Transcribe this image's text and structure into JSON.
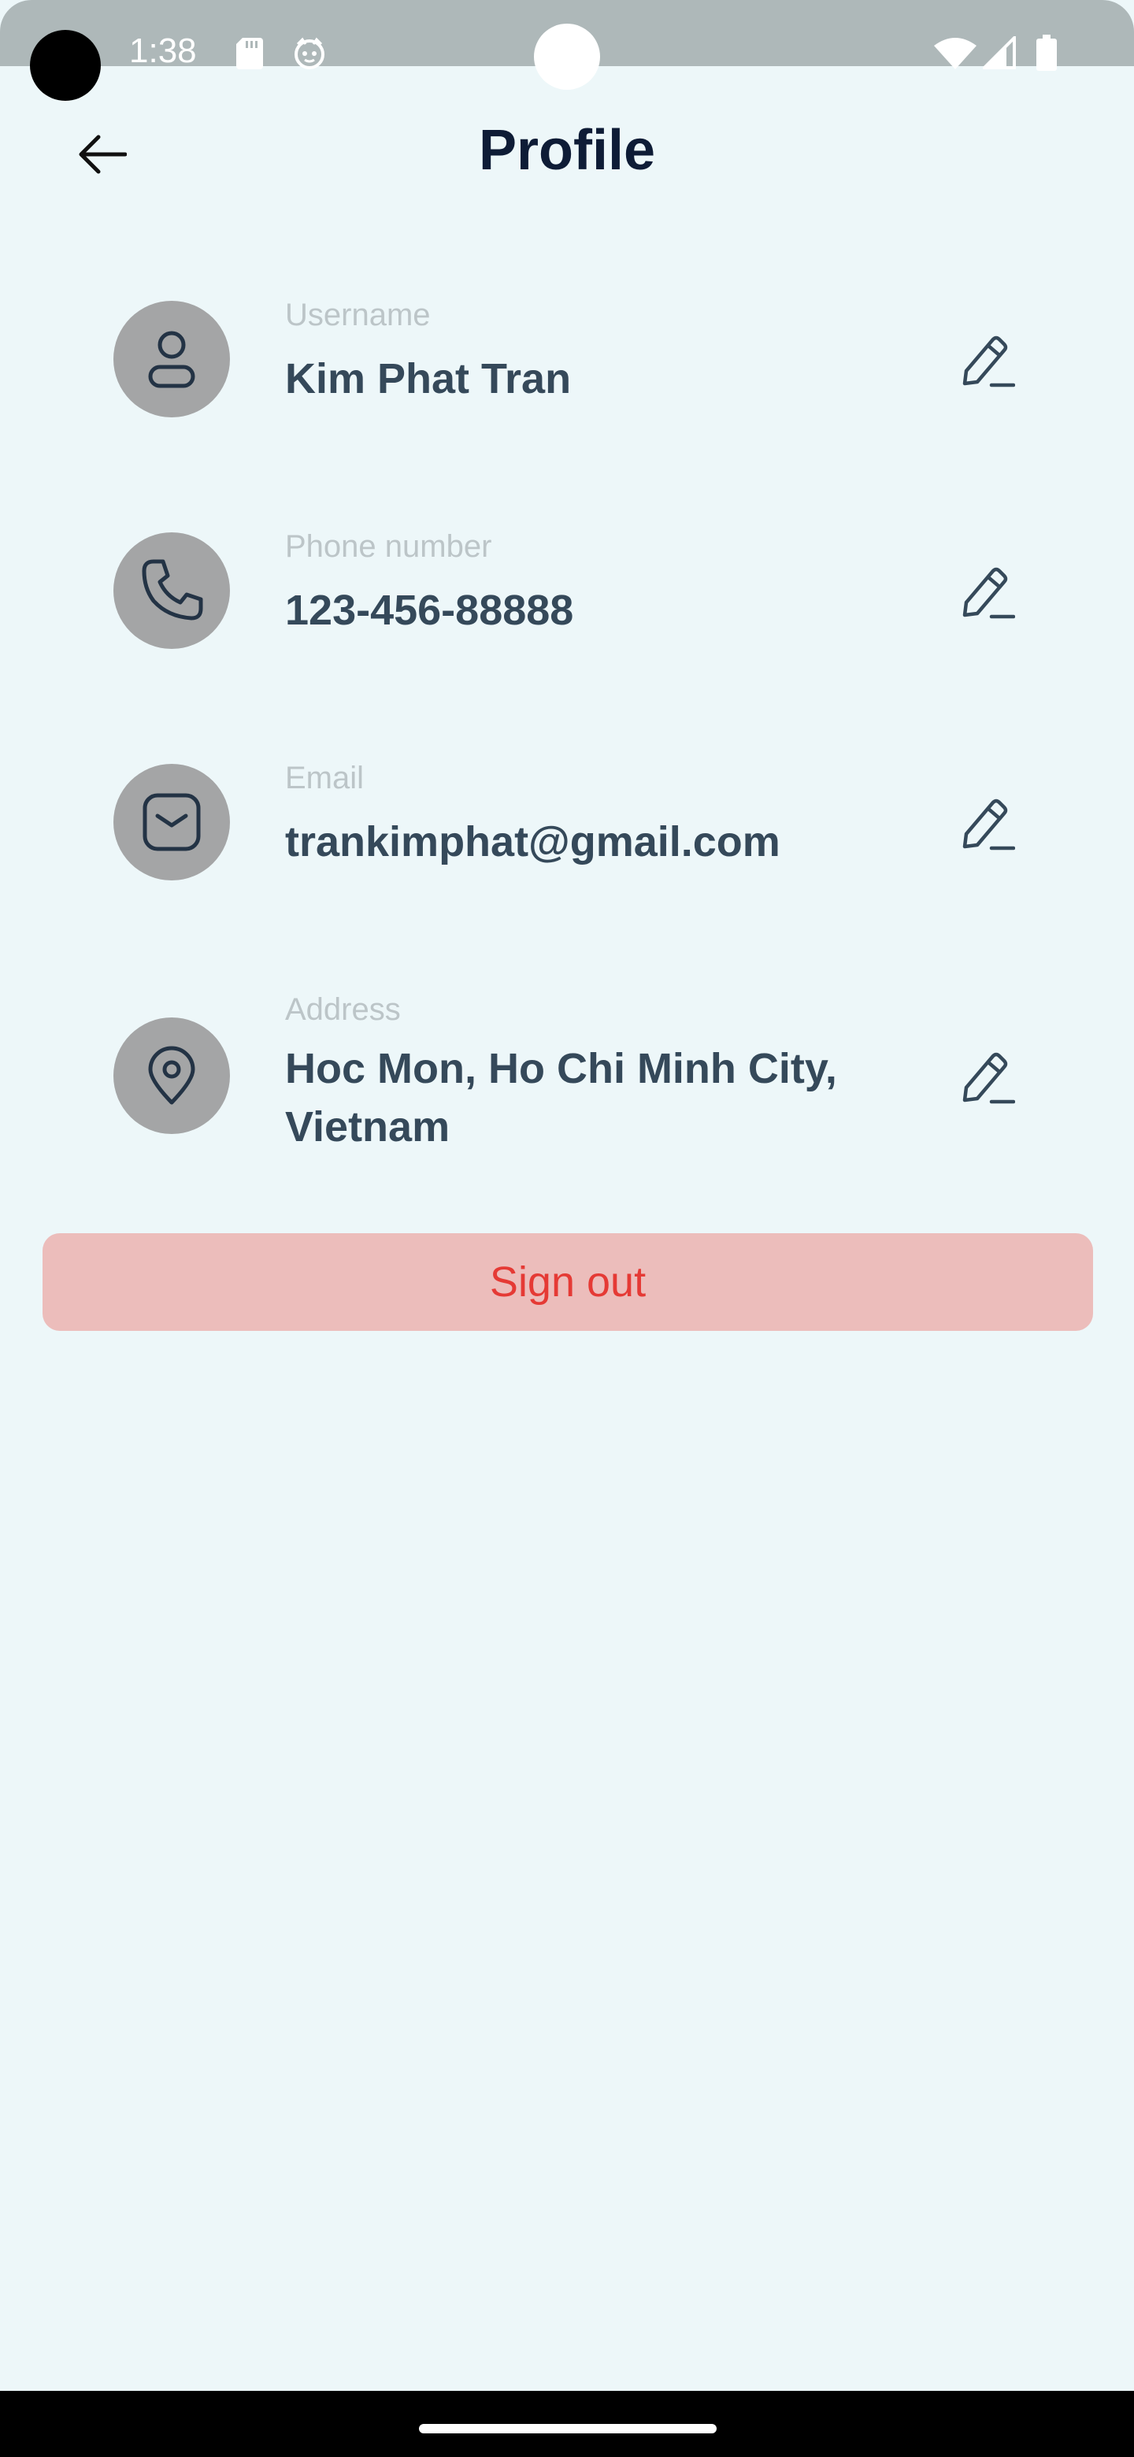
{
  "status_bar": {
    "time": "1:38",
    "icons": [
      "sd-card-icon",
      "cat-icon",
      "wifi-icon",
      "signal-icon",
      "battery-icon"
    ]
  },
  "header": {
    "title": "Profile",
    "back_icon": "arrow-left-icon"
  },
  "fields": [
    {
      "label": "Username",
      "value": "Kim Phat Tran",
      "icon": "user-icon"
    },
    {
      "label": "Phone number",
      "value": "123-456-88888",
      "icon": "phone-icon"
    },
    {
      "label": "Email",
      "value": "trankimphat@gmail.com",
      "icon": "mail-icon"
    },
    {
      "label": "Address",
      "value": "Hoc Mon, Ho Chi Minh City, Vietnam",
      "icon": "location-pin-icon"
    }
  ],
  "actions": {
    "sign_out_label": "Sign out",
    "edit_icon": "pencil-icon"
  },
  "colors": {
    "background": "#edf7f9",
    "title": "#0e1c36",
    "value_text": "#35495a",
    "label_text": "#bcc5c8",
    "icon_circle": "#a4a5a6",
    "sign_out_bg": "#ecbdbb",
    "sign_out_text": "#e53a35"
  }
}
